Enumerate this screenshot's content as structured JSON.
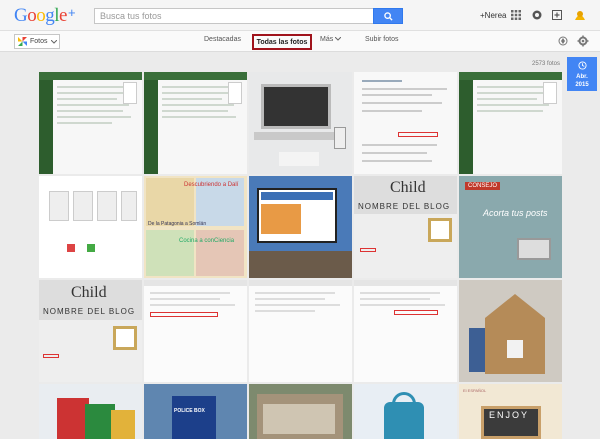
{
  "app": {
    "logo_text": "Google",
    "logo_plus": "+",
    "brand_colors": [
      "#4285f4",
      "#ea4335",
      "#fbbc05",
      "#4285f4",
      "#34a853",
      "#ea4335"
    ]
  },
  "header": {
    "search_placeholder": "Busca tus fotos",
    "user_name": "+Nerea"
  },
  "nav": {
    "fotos_label": "Fotos",
    "items": [
      {
        "label": "Destacadas"
      },
      {
        "label": "Todas las fotos"
      },
      {
        "label": "Más"
      },
      {
        "label": "Subir fotos"
      }
    ]
  },
  "content": {
    "count_text": "2573 fotos",
    "date_badge": {
      "line1": "Abr.",
      "line2": "2015"
    },
    "tile_texts": {
      "blog_name": "NOMBRE DEL BLOG",
      "child": "Child",
      "consejo": "CONSEJO",
      "acorta": "Acorta tus posts",
      "enjoy": "ENJOY",
      "espanol": "El ESPAÑOL",
      "dali": "Descubriendo a Dalí",
      "patagonia": "De la Patagonia a Somlán",
      "cocina": "Cocina a conCiencia",
      "police": "POLICE BOX"
    }
  },
  "colors": {
    "accent": "#4285f4",
    "highlight_border": "#a0131c"
  }
}
